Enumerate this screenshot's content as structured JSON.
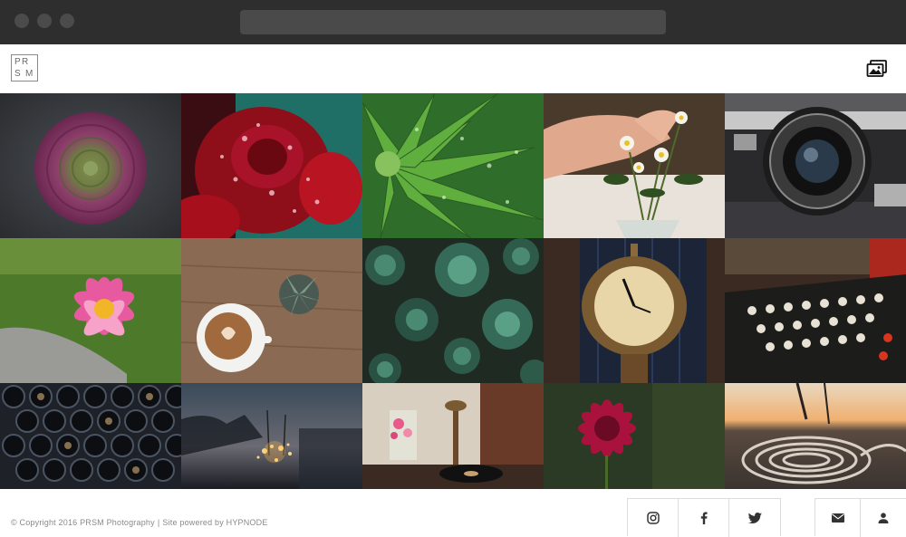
{
  "site": {
    "logo_letters": [
      "P",
      "R",
      "S",
      "M"
    ],
    "gallery_icon": "gallery-images-icon"
  },
  "gallery": {
    "photos": [
      {
        "subject": "purple succulent rosette",
        "icon": "photo"
      },
      {
        "subject": "red peony with water drops",
        "icon": "photo"
      },
      {
        "subject": "green aloe with dew",
        "icon": "photo"
      },
      {
        "subject": "hand holding daisies in vase",
        "icon": "photo"
      },
      {
        "subject": "vintage rangefinder camera lens",
        "icon": "photo"
      },
      {
        "subject": "pink water lily",
        "icon": "photo"
      },
      {
        "subject": "latte and succulent on wood table",
        "icon": "photo"
      },
      {
        "subject": "succulent bed",
        "icon": "photo"
      },
      {
        "subject": "station clock at night",
        "icon": "photo"
      },
      {
        "subject": "typewriter keys",
        "icon": "photo"
      },
      {
        "subject": "stacked pipes",
        "icon": "photo"
      },
      {
        "subject": "sparklers at dusk",
        "icon": "photo"
      },
      {
        "subject": "vintage telephone and record player",
        "icon": "photo"
      },
      {
        "subject": "crimson dahlia",
        "icon": "photo"
      },
      {
        "subject": "boat rope at sunset",
        "icon": "photo"
      }
    ]
  },
  "footer": {
    "copyright_text": "© Copyright 2016 PRSM Photography",
    "separator": "|",
    "powered_prefix": "Site powered by",
    "powered_link": "HYPNODE",
    "social": [
      {
        "name": "instagram",
        "icon": "instagram-icon"
      },
      {
        "name": "facebook",
        "icon": "facebook-icon"
      },
      {
        "name": "twitter",
        "icon": "twitter-icon"
      }
    ],
    "contact": [
      {
        "name": "email",
        "icon": "mail-icon"
      },
      {
        "name": "account",
        "icon": "user-icon"
      }
    ]
  },
  "colors": {
    "chrome": "#2e2e2e",
    "border": "#dcdcdc",
    "footer_text": "#8a8a8a"
  }
}
